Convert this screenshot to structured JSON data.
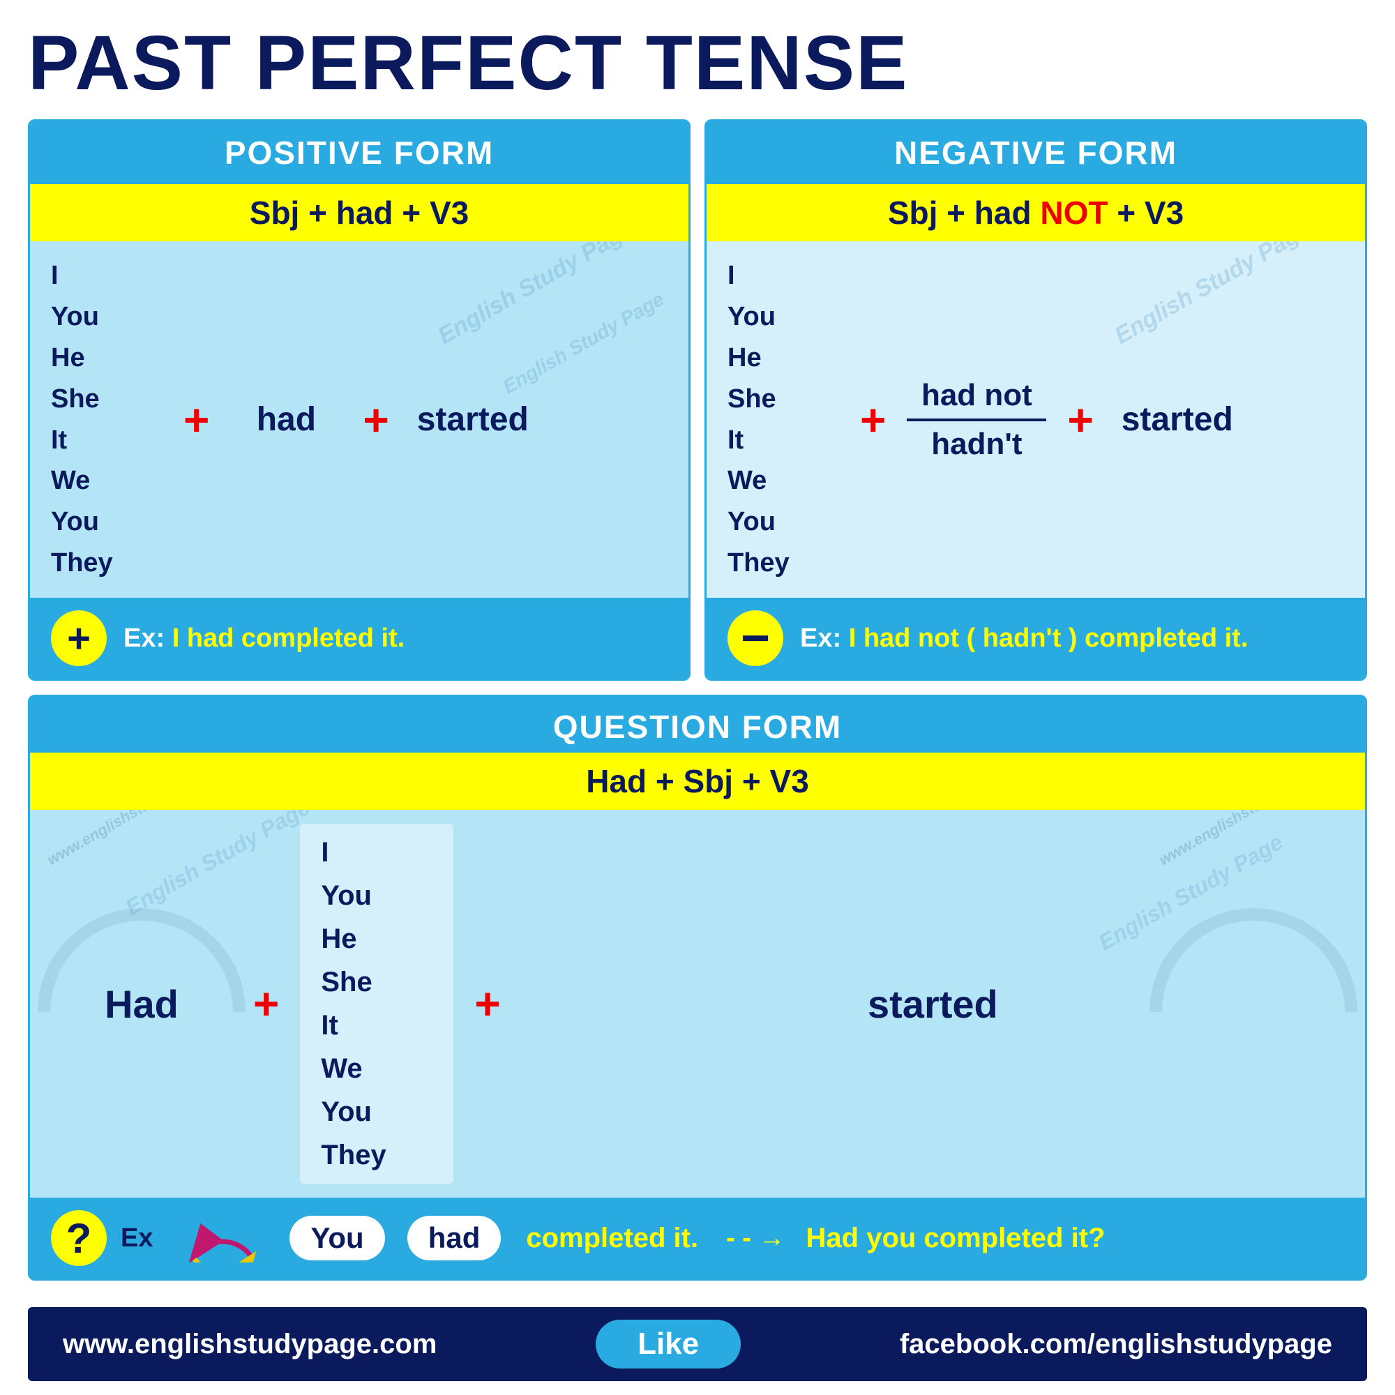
{
  "title": "PAST PERFECT TENSE",
  "positive": {
    "header": "POSITIVE FORM",
    "formula": "Sbj + had + V3",
    "subjects": "I\nYou\nHe\nShe\nIt\nWe\nYou\nThey",
    "had": "had",
    "started": "started",
    "example_label": "Ex:",
    "example": "I had completed it."
  },
  "negative": {
    "header": "NEGATIVE FORM",
    "formula_before": "Sbj + had ",
    "formula_not": "NOT",
    "formula_after": " + V3",
    "subjects": "I\nYou\nHe\nShe\nIt\nWe\nYou\nThey",
    "had_not": "had not",
    "hadnt": "hadn't",
    "started": "started",
    "example_label": "Ex:",
    "example": "I had not ( hadn't ) completed it."
  },
  "question": {
    "header": "QUESTION FORM",
    "formula": "Had +  Sbj + V3",
    "had": "Had",
    "subjects": "I\nYou\nHe\nShe\nIt\nWe\nYou\nThey",
    "started": "started",
    "example_label": "Ex",
    "you_word": "You",
    "had_word": "had",
    "completed": "completed it.",
    "result": "Had you completed it?"
  },
  "footer": {
    "url": "www.englishstudypage.com",
    "like": "Like",
    "facebook": "facebook.com/englishstudypage"
  },
  "watermark": "English Study Page"
}
